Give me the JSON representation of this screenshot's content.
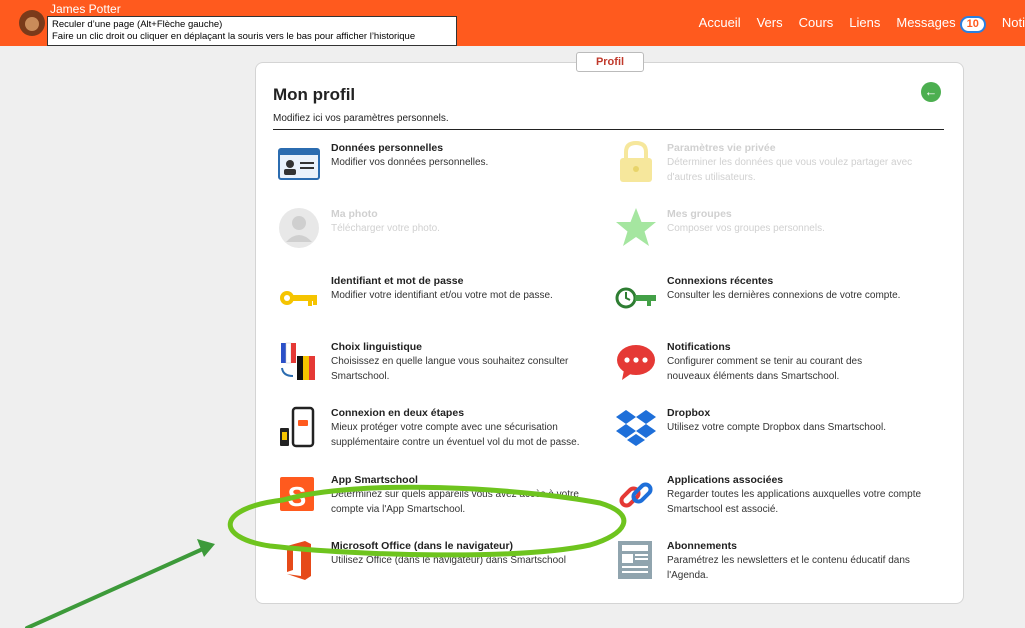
{
  "user": {
    "name": "James Potter"
  },
  "tooltip": {
    "line1": "Reculer d’une page (Alt+Flèche gauche)",
    "line2": "Faire un clic droit ou cliquer en déplaçant la souris vers le bas pour afficher l’historique"
  },
  "nav": {
    "home": "Accueil",
    "to": "Vers",
    "courses": "Cours",
    "links": "Liens",
    "messages": "Messages",
    "messages_count": "10",
    "notifications": "Noti"
  },
  "page": {
    "tab": "Profil",
    "title": "Mon profil",
    "subtitle": "Modifiez ici vos paramètres personnels."
  },
  "items": [
    {
      "title": "Données personnelles",
      "desc": "Modifier vos données personnelles."
    },
    {
      "title": "Paramètres vie privée",
      "desc": "Déterminer les données que vous voulez partager avec d'autres utilisateurs."
    },
    {
      "title": "Ma photo",
      "desc": "Télécharger votre photo."
    },
    {
      "title": "Mes groupes",
      "desc": "Composer vos groupes personnels."
    },
    {
      "title": "Identifiant et mot de passe",
      "desc": "Modifier votre identifiant et/ou votre mot de passe."
    },
    {
      "title": "Connexions récentes",
      "desc": "Consulter les dernières connexions de votre compte."
    },
    {
      "title": "Choix linguistique",
      "desc": "Choisissez en quelle langue vous souhaitez consulter Smartschool."
    },
    {
      "title": "Notifications",
      "desc": "Configurer comment se tenir au courant des nouveaux éléments dans Smartschool."
    },
    {
      "title": "Connexion en deux étapes",
      "desc": "Mieux protéger votre compte avec une sécurisation supplémentaire contre un éventuel vol du mot de passe."
    },
    {
      "title": "Dropbox",
      "desc": "Utilisez votre compte Dropbox dans Smartschool."
    },
    {
      "title": "App Smartschool",
      "desc": "Déterminez sur quels appareils vous avez accès à votre compte via l'App Smartschool."
    },
    {
      "title": "Applications associées",
      "desc": "Regarder toutes les applications auxquelles votre compte Smartschool est associé."
    },
    {
      "title": "Microsoft Office (dans le navigateur)",
      "desc": "Utilisez Office (dans le navigateur) dans Smartschool"
    },
    {
      "title": "Abonnements",
      "desc": "Paramétrez les newsletters et le contenu éducatif dans l'Agenda."
    }
  ],
  "colors": {
    "brand": "#ff5a1e",
    "annotation_green": "#6ec41e",
    "arrow_green": "#3d9a3a"
  }
}
